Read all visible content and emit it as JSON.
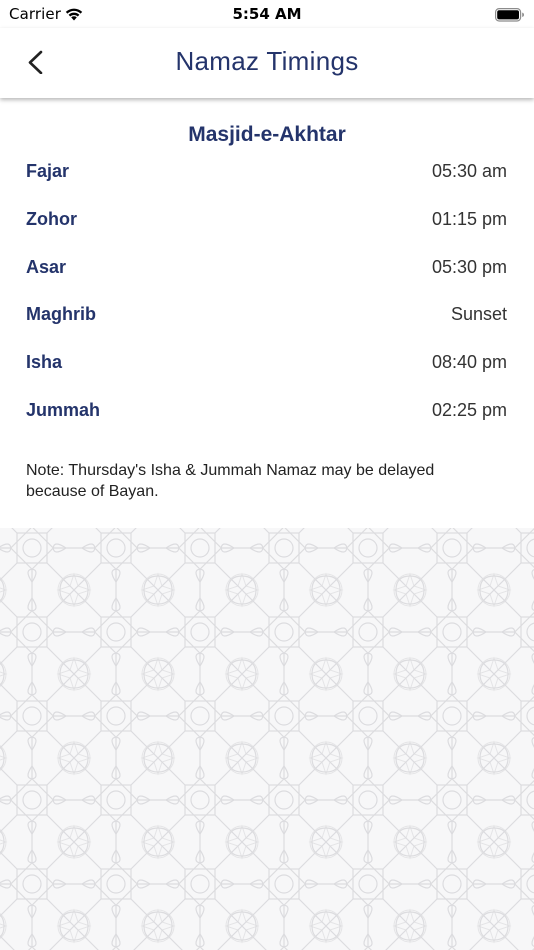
{
  "status_bar": {
    "carrier": "Carrier",
    "time": "5:54 AM",
    "icons": [
      "wifi-icon",
      "battery-icon"
    ]
  },
  "nav": {
    "back_icon": "chevron-left-icon",
    "title": "Namaz Timings"
  },
  "masjid": {
    "name": "Masjid-e-Akhtar"
  },
  "prayers": [
    {
      "name": "Fajar",
      "time": "05:30 am"
    },
    {
      "name": "Zohor",
      "time": "01:15 pm"
    },
    {
      "name": "Asar",
      "time": "05:30 pm"
    },
    {
      "name": "Maghrib",
      "time": "Sunset"
    },
    {
      "name": "Isha",
      "time": "08:40 pm"
    },
    {
      "name": "Jummah",
      "time": "02:25 pm"
    }
  ],
  "note": "Note: Thursday's Isha & Jummah Namaz may be delayed because of Bayan.",
  "colors": {
    "accent": "#24346b",
    "pattern_bg": "#f7f7f8",
    "pattern_line": "#dcdcdf"
  }
}
